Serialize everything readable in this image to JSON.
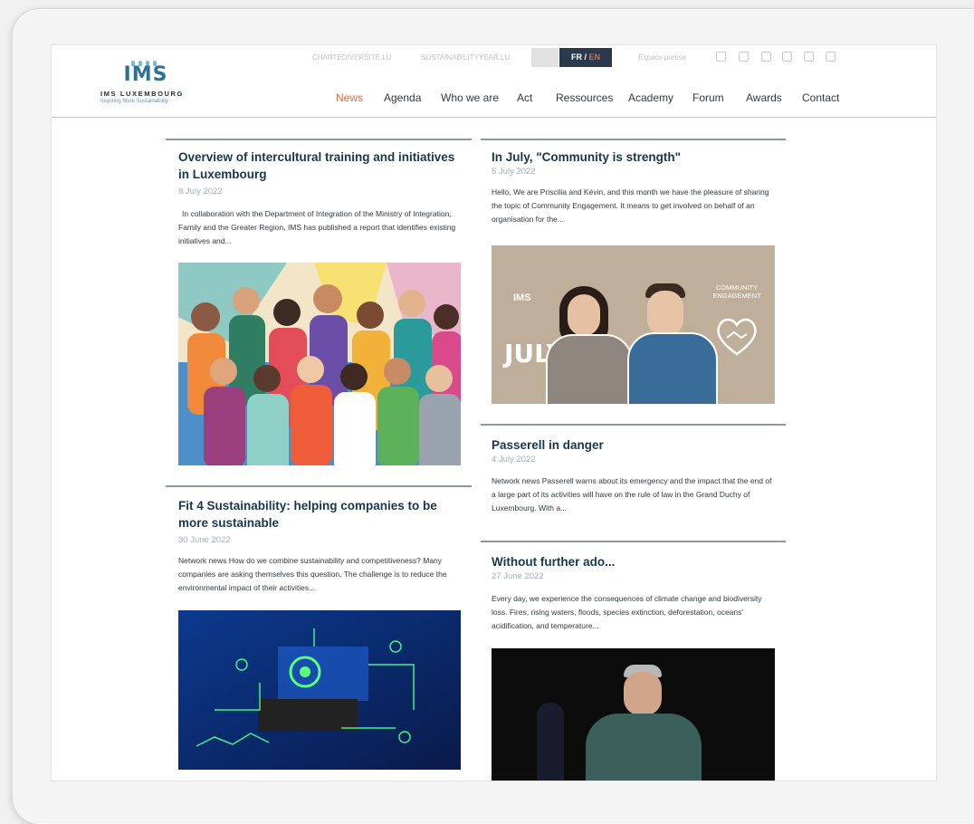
{
  "site": {
    "logo_mark": "IMS",
    "logo_brand": "IMS LUXEMBOURG",
    "logo_tagline": "Inspiring More Sustainability"
  },
  "toplinks": {
    "site1": "CHARTEDIVERSITE.LU",
    "site2": "SUSTAINABILITYYEAR.LU",
    "lang_fr": "FR",
    "lang_sep": " / ",
    "lang_en": "EN",
    "press": "Espace presse"
  },
  "nav": [
    "News",
    "Agenda",
    "Who we are",
    "Act",
    "Ressources",
    "Academy",
    "Forum",
    "Awards",
    "Contact"
  ],
  "articles": [
    {
      "title": "Overview of intercultural training and initiatives in Luxembourg",
      "date": "8 July 2022",
      "excerpt": "In collaboration with the Department of Integration of the Ministry of Integration, Family and the Greater Region, IMS has published a report that identifies existing initiatives and..."
    },
    {
      "title": "In July, \"Community is strength\"",
      "date": "5 July 2022",
      "excerpt": "Hello, We are Priscilia and Kévin, and this month we have the pleasure of sharing the topic of Community Engagement. It means to get involved on behalf of an organisation for the...",
      "image_text_left": "JULY",
      "image_text_right": "COMMUNITY ENGAGEMENT"
    },
    {
      "title": "Passerell in danger",
      "date": "4 July 2022",
      "excerpt": "Network news Passerell warns about its emergency and the impact that the end of a large part of its activities will have on the rule of law in the Grand Duchy of Luxembourg. With a..."
    },
    {
      "title": "Fit 4 Sustainability: helping companies to be more sustainable",
      "date": "30 June 2022",
      "excerpt": "Network news How do we combine sustainability and competitiveness? Many companies are asking themselves this question. The challenge is to reduce the environmental impact of their activities..."
    },
    {
      "title": "Without further ado...",
      "date": "27 June 2022",
      "excerpt": "Every day, we experience the consequences of climate change and biodiversity loss. Fires, rising waters, floods, species extinction, deforestation, oceans' acidification, and temperature..."
    }
  ],
  "colors": {
    "accent": "#e06a3b",
    "title": "#17384c",
    "date": "#9fb1bf",
    "lang_bg": "#2a3a4c"
  }
}
